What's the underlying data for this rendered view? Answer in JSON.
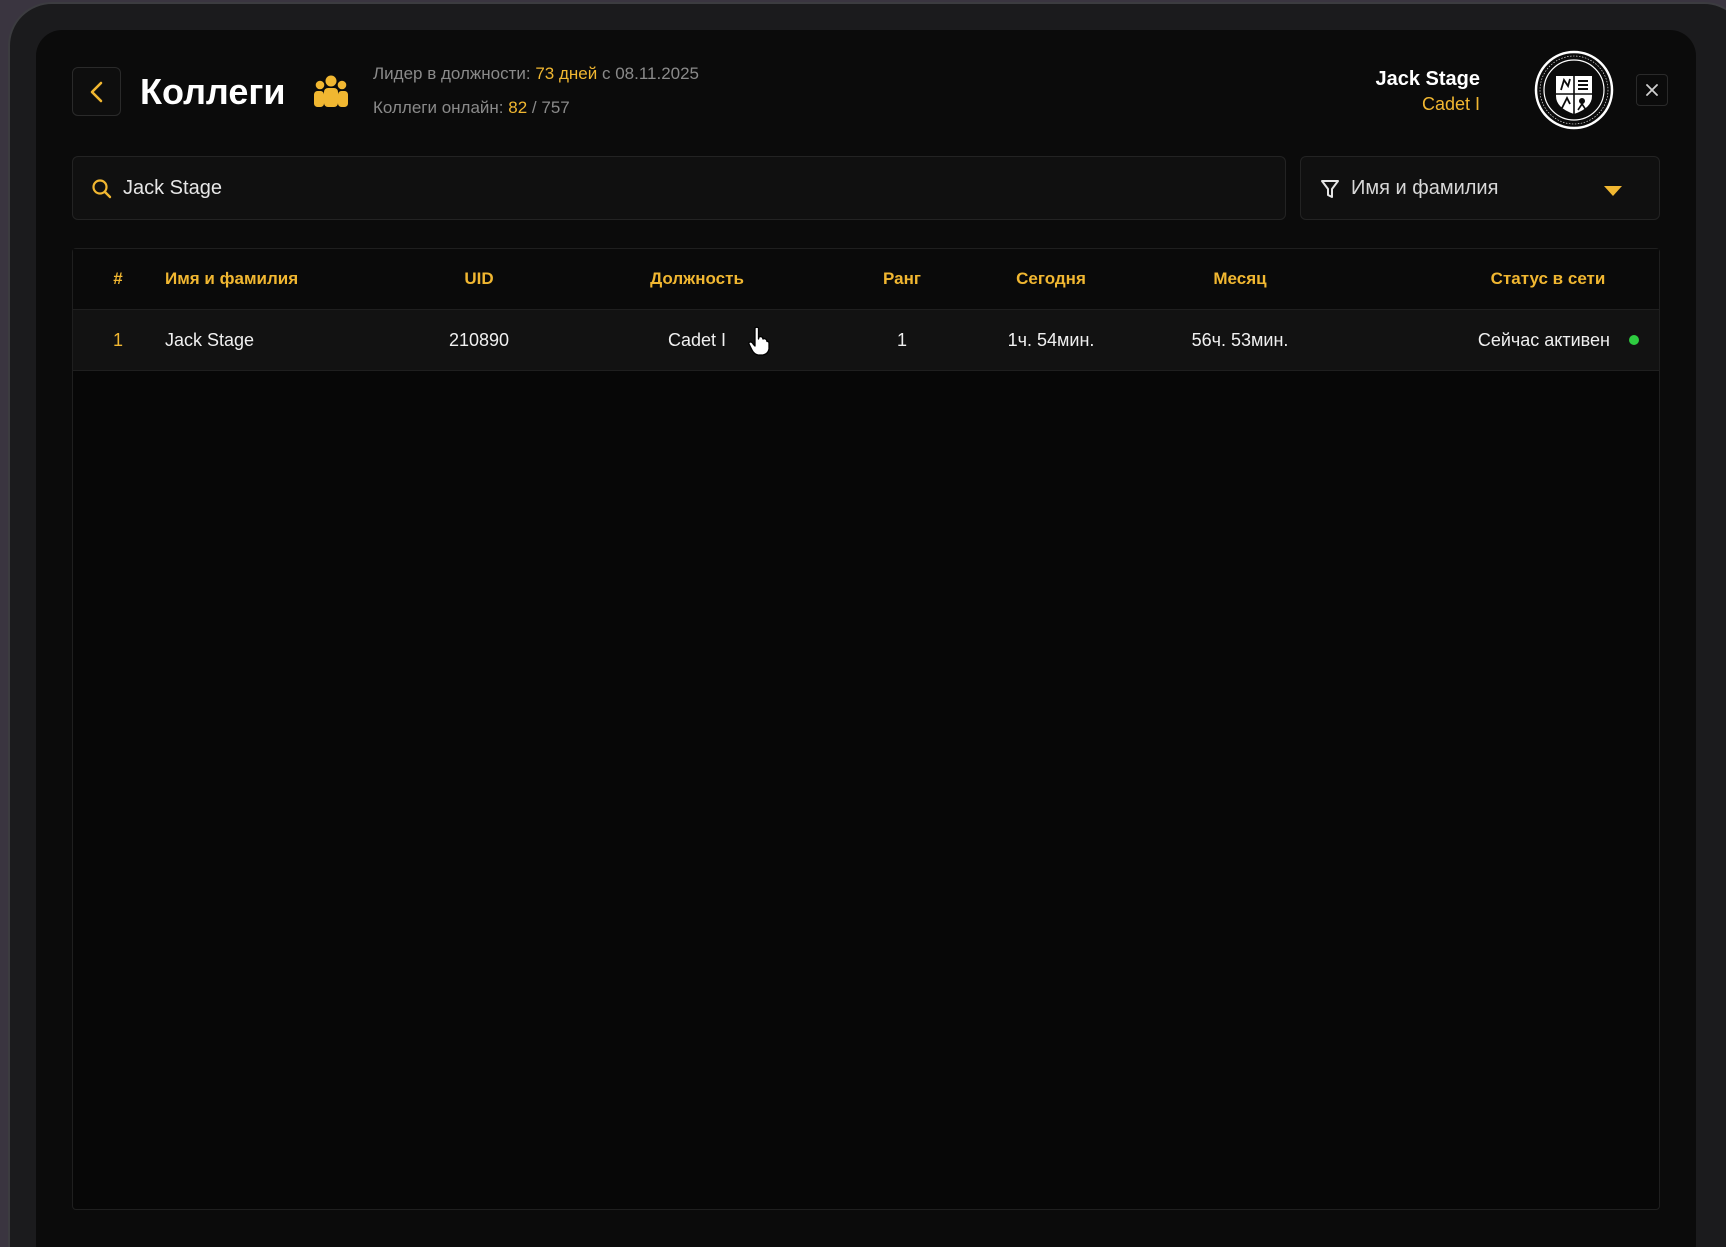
{
  "header": {
    "title": "Коллеги",
    "leader_label": "Лидер в должности:",
    "leader_days": "73 дней",
    "leader_since": "с 08.11.2025",
    "online_label": "Коллеги онлайн:",
    "online_count": "82",
    "online_total": "/ 757"
  },
  "user": {
    "name": "Jack Stage",
    "role": "Cadet I"
  },
  "search": {
    "value": "Jack Stage",
    "placeholder": ""
  },
  "filter": {
    "selected": "Имя и фамилия"
  },
  "table": {
    "columns": [
      "#",
      "Имя и фамилия",
      "UID",
      "Должность",
      "Ранг",
      "Сегодня",
      "Месяц",
      "Статус в сети"
    ],
    "rows": [
      {
        "index": "1",
        "name": "Jack Stage",
        "uid": "210890",
        "position": "Cadet I",
        "rank": "1",
        "today": "1ч. 54мин.",
        "month": "56ч. 53мин.",
        "status": "Сейчас активен"
      }
    ]
  },
  "colors": {
    "accent": "#f1b731",
    "online": "#2ecc40",
    "background": "#0b0b0b"
  },
  "icons": [
    "back-chevron-icon",
    "people-icon",
    "emblem-seal",
    "close-icon",
    "search-icon",
    "filter-icon",
    "chevron-down-icon",
    "hand-cursor-icon"
  ]
}
